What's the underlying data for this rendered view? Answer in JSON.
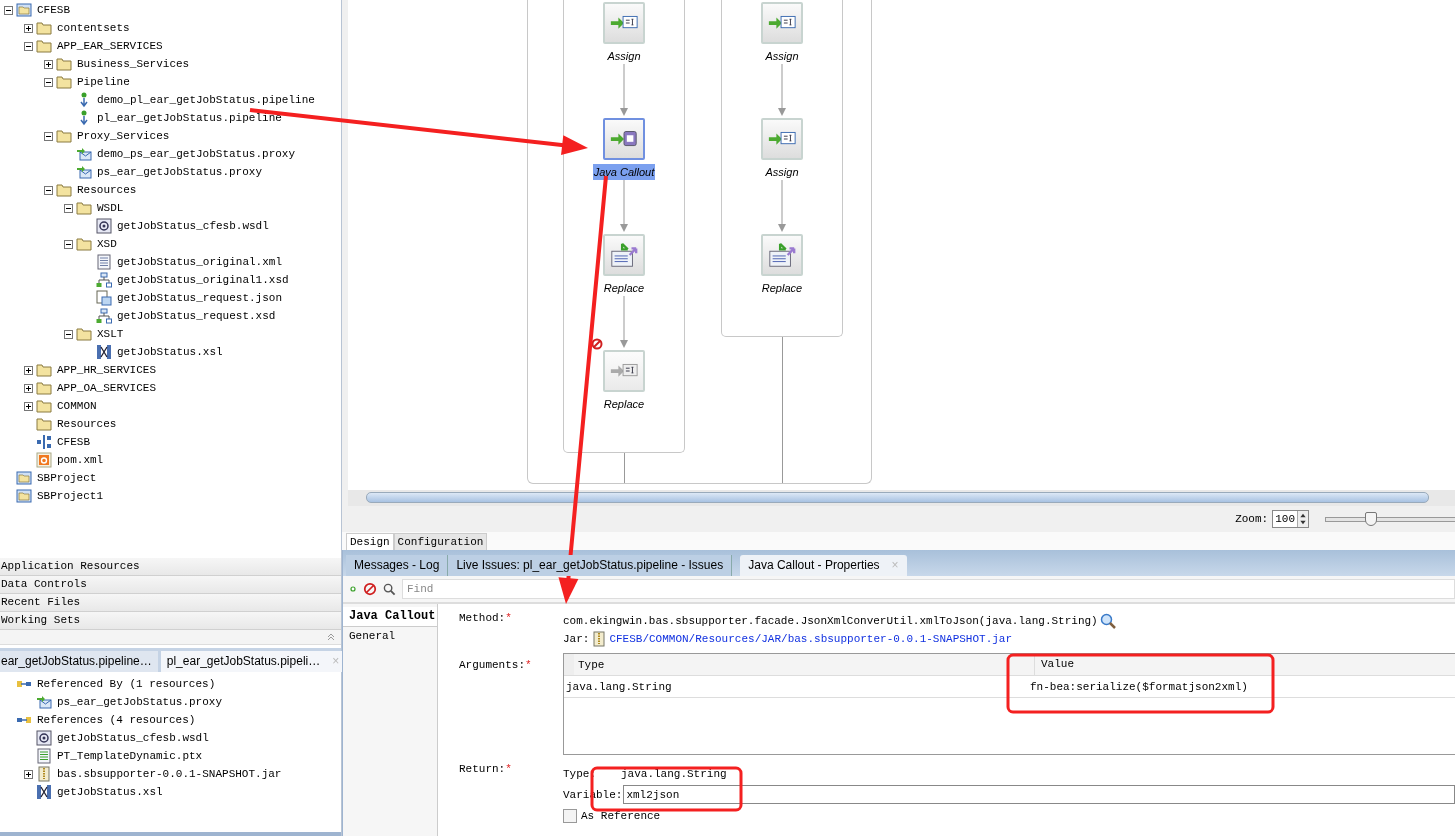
{
  "project_tree": [
    {
      "label": "CFESB",
      "kind": "project",
      "expanded": true,
      "children": [
        {
          "label": "contentsets",
          "kind": "folder",
          "expanded": false
        },
        {
          "label": "APP_EAR_SERVICES",
          "kind": "folder",
          "expanded": true,
          "children": [
            {
              "label": "Business_Services",
              "kind": "folder",
              "expanded": false
            },
            {
              "label": "Pipeline",
              "kind": "folder",
              "expanded": true,
              "children": [
                {
                  "label": "demo_pl_ear_getJobStatus.pipeline",
                  "kind": "pipeline"
                },
                {
                  "label": "pl_ear_getJobStatus.pipeline",
                  "kind": "pipeline"
                }
              ]
            },
            {
              "label": "Proxy_Services",
              "kind": "folder",
              "expanded": true,
              "children": [
                {
                  "label": "demo_ps_ear_getJobStatus.proxy",
                  "kind": "proxy"
                },
                {
                  "label": "ps_ear_getJobStatus.proxy",
                  "kind": "proxy"
                }
              ]
            },
            {
              "label": "Resources",
              "kind": "folder",
              "expanded": true,
              "children": [
                {
                  "label": "WSDL",
                  "kind": "folder",
                  "expanded": true,
                  "children": [
                    {
                      "label": "getJobStatus_cfesb.wsdl",
                      "kind": "wsdl"
                    }
                  ]
                },
                {
                  "label": "XSD",
                  "kind": "folder",
                  "expanded": true,
                  "children": [
                    {
                      "label": "getJobStatus_original.xml",
                      "kind": "xml"
                    },
                    {
                      "label": "getJobStatus_original1.xsd",
                      "kind": "xsd"
                    },
                    {
                      "label": "getJobStatus_request.json",
                      "kind": "json"
                    },
                    {
                      "label": "getJobStatus_request.xsd",
                      "kind": "xsd"
                    }
                  ]
                },
                {
                  "label": "XSLT",
                  "kind": "folder",
                  "expanded": true,
                  "children": [
                    {
                      "label": "getJobStatus.xsl",
                      "kind": "xsl"
                    }
                  ]
                }
              ]
            }
          ]
        },
        {
          "label": "APP_HR_SERVICES",
          "kind": "folder",
          "expanded": false
        },
        {
          "label": "APP_OA_SERVICES",
          "kind": "folder",
          "expanded": false
        },
        {
          "label": "COMMON",
          "kind": "folder",
          "expanded": false
        },
        {
          "label": "Resources",
          "kind": "folder"
        },
        {
          "label": "CFESB",
          "kind": "bus"
        },
        {
          "label": "pom.xml",
          "kind": "maven"
        }
      ]
    },
    {
      "label": "SBProject",
      "kind": "project"
    },
    {
      "label": "SBProject1",
      "kind": "project"
    }
  ],
  "accordion": [
    "Application Resources",
    "Data Controls",
    "Recent Files",
    "Working Sets"
  ],
  "reference_tabs": [
    {
      "label": "ear_getJobStatus.pipeline…",
      "selected": false
    },
    {
      "label": "pl_ear_getJobStatus.pipeli…",
      "selected": true,
      "close": "×"
    }
  ],
  "reference_tree": [
    {
      "label": "Referenced By (1 resources)",
      "kind": "refby",
      "children": [
        {
          "label": "ps_ear_getJobStatus.proxy",
          "kind": "proxy"
        }
      ]
    },
    {
      "label": "References (4 resources)",
      "kind": "refs",
      "children": [
        {
          "label": "getJobStatus_cfesb.wsdl",
          "kind": "wsdl"
        },
        {
          "label": "PT_TemplateDynamic.ptx",
          "kind": "ptx"
        },
        {
          "label": "bas.sbsupporter-0.0.1-SNAPSHOT.jar",
          "kind": "jar",
          "expanded": false
        },
        {
          "label": "getJobStatus.xsl",
          "kind": "xsl"
        }
      ]
    }
  ],
  "pipeline": {
    "lanes": [
      {
        "nodes": [
          {
            "label": "Assign",
            "kind": "assign",
            "selected": false,
            "disabled": false
          },
          {
            "label": "Java Callout",
            "kind": "java",
            "selected": true,
            "disabled": false
          },
          {
            "label": "Replace",
            "kind": "replace",
            "selected": false,
            "disabled": false
          },
          {
            "label": "Replace",
            "kind": "assign",
            "selected": false,
            "disabled": true
          }
        ]
      },
      {
        "nodes": [
          {
            "label": "Assign",
            "kind": "assign",
            "selected": false,
            "disabled": false
          },
          {
            "label": "Assign",
            "kind": "assign",
            "selected": false,
            "disabled": false
          },
          {
            "label": "Replace",
            "kind": "replace",
            "selected": false,
            "disabled": false
          }
        ]
      }
    ]
  },
  "zoom": {
    "label": "Zoom:",
    "value": "100",
    "level": 0.22
  },
  "editor_tabs": [
    {
      "label": "Design",
      "selected": true
    },
    {
      "label": "Configuration",
      "selected": false
    }
  ],
  "properties": {
    "tabs": [
      {
        "label": "Messages - Log",
        "selected": false
      },
      {
        "label": "Live Issues: pl_ear_getJobStatus.pipeline - Issues",
        "selected": false
      },
      {
        "label": "Java Callout - Properties",
        "selected": true,
        "close": "×"
      }
    ],
    "search_placeholder": "Find",
    "nav": [
      {
        "label": "Java Callout",
        "selected": true
      },
      {
        "label": "General",
        "selected": false
      }
    ],
    "method": {
      "label": "Method:",
      "required_mark": "*",
      "value": "com.ekingwin.bas.sbsupporter.facade.JsonXmlConverUtil.xmlToJson(java.lang.String)"
    },
    "jar": {
      "label": "Jar:",
      "path": "CFESB/COMMON/Resources/JAR/bas.sbsupporter-0.0.1-SNAPSHOT.jar"
    },
    "arguments": {
      "label": "Arguments:",
      "required_mark": "*",
      "columns": [
        "Type",
        "Value"
      ],
      "rows": [
        [
          "java.lang.String",
          "fn-bea:serialize($formatjson2xml)"
        ]
      ]
    },
    "return": {
      "label": "Return:",
      "required_mark": "*",
      "type_label": "Type:",
      "type": "java.lang.String",
      "variable_label": "Variable:",
      "variable": "xml2json",
      "as_reference": {
        "label": "As Reference",
        "checked": false
      }
    }
  },
  "annotations": [
    {
      "kind": "arrow"
    },
    {
      "kind": "arrow"
    },
    {
      "kind": "box"
    },
    {
      "kind": "box"
    }
  ]
}
